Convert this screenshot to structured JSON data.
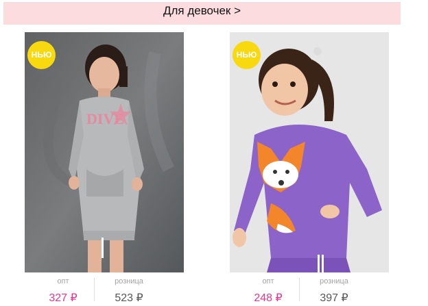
{
  "category": {
    "label": "Для девочек >"
  },
  "products": [
    {
      "badge": "НЬЮ",
      "price_labels": {
        "wholesale": "опт",
        "retail": "розница"
      },
      "wholesale_price": "327 ₽",
      "retail_price": "523 ₽",
      "image_text": "DIVE"
    },
    {
      "badge": "НЬЮ",
      "price_labels": {
        "wholesale": "опт",
        "retail": "розница"
      },
      "wholesale_price": "248 ₽",
      "retail_price": "397 ₽"
    }
  ],
  "colors": {
    "category_bg": "#fcdcdf",
    "badge": "#f8d90f",
    "wholesale_price": "#e9338c",
    "retail_price": "#555555"
  }
}
